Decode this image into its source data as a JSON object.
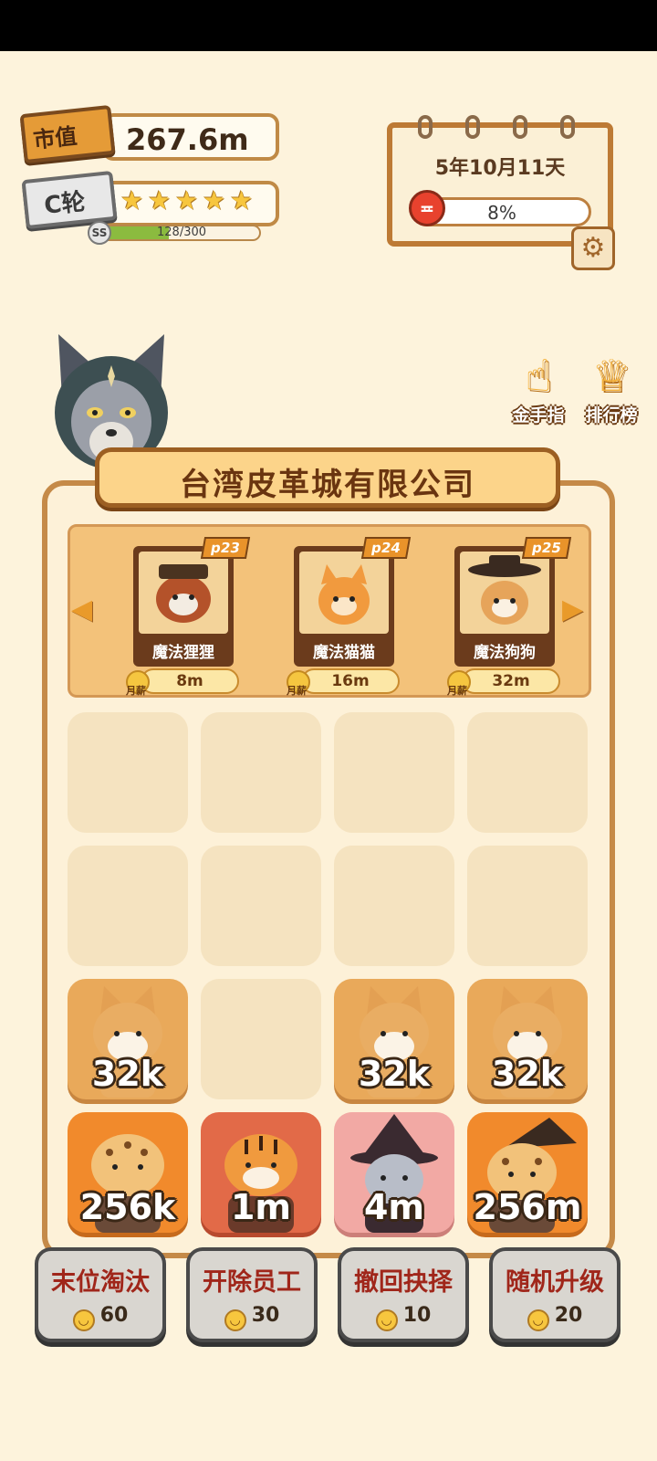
{
  "header": {
    "market_value_label": "市值",
    "market_value": "267.6m",
    "round_label": "C轮",
    "stars": 5,
    "rank_badge": "SS",
    "exp_text": "128/300",
    "exp_progress": 0.4267
  },
  "calendar": {
    "date": "5年10月11天",
    "mood_percent": "8%",
    "mood_icon": "angry-face-icon",
    "settings_icon": "gear-icon"
  },
  "side_buttons": [
    {
      "label": "金手指",
      "icon": "pointing-hand-icon"
    },
    {
      "label": "排行榜",
      "icon": "trophy-icon"
    }
  ],
  "company": {
    "name": "台湾皮革城有限公司"
  },
  "shop": {
    "cards": [
      {
        "tag": "p23",
        "name": "魔法狸狸",
        "price": "8m",
        "salary_tag": "月薪"
      },
      {
        "tag": "p24",
        "name": "魔法猫猫",
        "price": "16m",
        "salary_tag": "月薪"
      },
      {
        "tag": "p25",
        "name": "魔法狗狗",
        "price": "32m",
        "salary_tag": "月薪"
      }
    ]
  },
  "grid": {
    "rows": [
      [
        {
          "value": ""
        },
        {
          "value": ""
        },
        {
          "value": ""
        },
        {
          "value": ""
        }
      ],
      [
        {
          "value": ""
        },
        {
          "value": ""
        },
        {
          "value": ""
        },
        {
          "value": ""
        }
      ],
      [
        {
          "value": "32k"
        },
        {
          "value": ""
        },
        {
          "value": "32k"
        },
        {
          "value": "32k"
        }
      ],
      [
        {
          "value": "256k"
        },
        {
          "value": "1m"
        },
        {
          "value": "4m"
        },
        {
          "value": "256m"
        }
      ]
    ]
  },
  "actions": [
    {
      "label": "末位淘汰",
      "cost": "60"
    },
    {
      "label": "开除员工",
      "cost": "30"
    },
    {
      "label": "撤回抉择",
      "cost": "10"
    },
    {
      "label": "随机升级",
      "cost": "20"
    }
  ],
  "colors": {
    "background": "#fdf3dc",
    "board_border": "#c58a48",
    "action_text": "#a0261a"
  }
}
